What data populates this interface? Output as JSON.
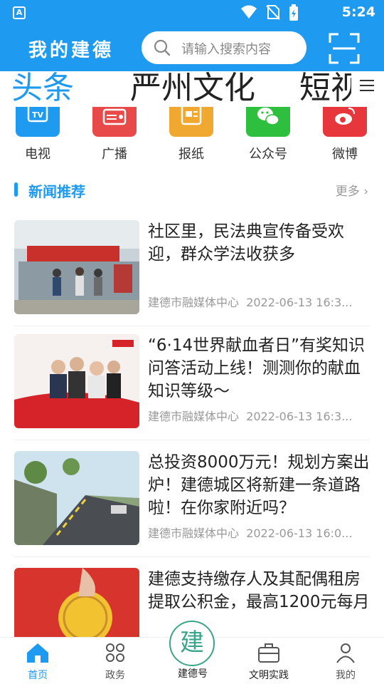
{
  "status_bar": {
    "time": "5:24",
    "left_icon": "A"
  },
  "header": {
    "title": "我的建德",
    "search_placeholder": "请输入搜索内容"
  },
  "tabs": [
    {
      "label": "头条",
      "active": true
    },
    {
      "label": "严州文化",
      "active": false
    },
    {
      "label": "短视",
      "active": false
    }
  ],
  "categories": [
    {
      "label": "电视",
      "icon": "tv-icon",
      "color": "#1e9bf0"
    },
    {
      "label": "广播",
      "icon": "radio-icon",
      "color": "#e84a4a"
    },
    {
      "label": "报纸",
      "icon": "newspaper-icon",
      "color": "#f0a830"
    },
    {
      "label": "公众号",
      "icon": "wechat-icon",
      "color": "#2fbf3f"
    },
    {
      "label": "微博",
      "icon": "weibo-icon",
      "color": "#e8373c"
    }
  ],
  "section": {
    "title": "新闻推荐",
    "more": "更多"
  },
  "news": [
    {
      "headline": "社区里，民法典宣传备受欢迎，群众学法收获多",
      "source": "建德市融媒体中心",
      "time": "2022-06-13 16:3..."
    },
    {
      "headline": "“6·14世界献血者日”有奖知识问答活动上线！测测你的献血知识等级～",
      "source": "建德市融媒体中心",
      "time": "2022-06-13 16:3..."
    },
    {
      "headline": "总投资8000万元！规划方案出炉！建德城区将新建一条道路啦！在你家附近吗？",
      "source": "建德市融媒体中心",
      "time": "2022-06-13 16:0..."
    },
    {
      "headline": "建德支持缴存人及其配偶租房提取公积金，最高1200元每月",
      "source": "",
      "time": ""
    }
  ],
  "bottom_nav": {
    "home": "首页",
    "gov": "政务",
    "center": "建德号",
    "center_glyph": "建",
    "civic": "文明实践",
    "mine": "我的"
  },
  "colors": {
    "primary": "#1e9bf0",
    "accent_green": "#3aa58a"
  }
}
